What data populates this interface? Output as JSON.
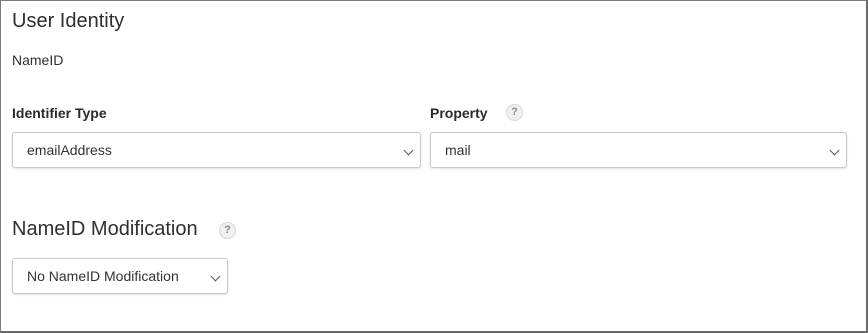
{
  "section": {
    "title": "User Identity",
    "subheading": "NameID"
  },
  "identifier_type": {
    "label": "Identifier Type",
    "selected": "emailAddress"
  },
  "property": {
    "label": "Property",
    "help_icon": "question-mark-icon",
    "selected": "mail"
  },
  "nameid_modification": {
    "title": "NameID Modification",
    "help_icon": "question-mark-icon",
    "selected": "No NameID Modification"
  },
  "icons": {
    "help_glyph": "?"
  }
}
